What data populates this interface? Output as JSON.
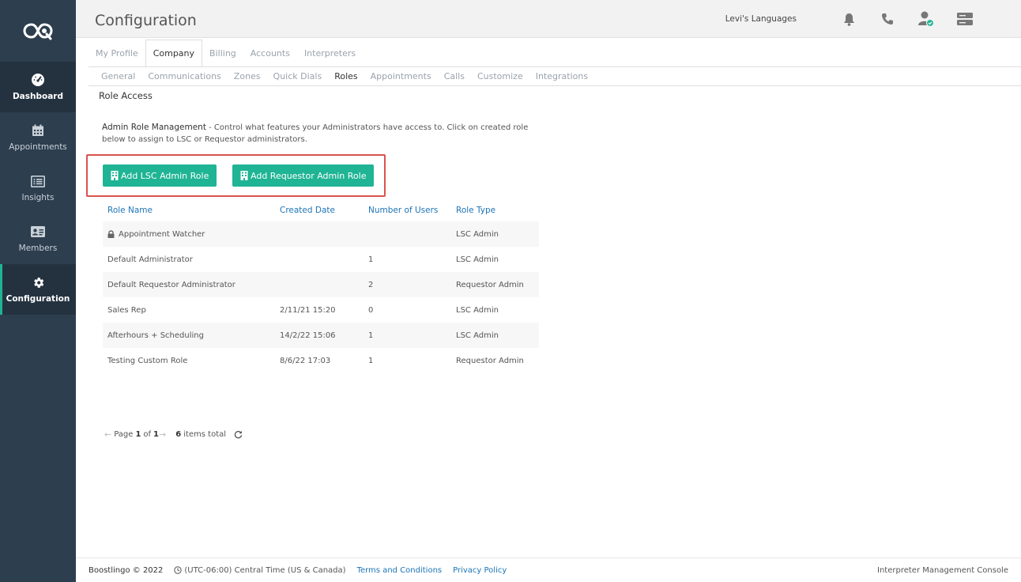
{
  "header": {
    "title": "Configuration",
    "account_name": "Levi's Languages"
  },
  "sidebar": {
    "items": [
      {
        "label": "Dashboard",
        "icon": "gauge-icon"
      },
      {
        "label": "Appointments",
        "icon": "calendar-icon"
      },
      {
        "label": "Insights",
        "icon": "list-icon"
      },
      {
        "label": "Members",
        "icon": "id-card-icon"
      },
      {
        "label": "Configuration",
        "icon": "gear-icon"
      }
    ]
  },
  "tabs": [
    "My Profile",
    "Company",
    "Billing",
    "Accounts",
    "Interpreters"
  ],
  "subtabs": [
    "General",
    "Communications",
    "Zones",
    "Quick Dials",
    "Roles",
    "Appointments",
    "Calls",
    "Customize",
    "Integrations"
  ],
  "section_title": "Role Access",
  "description": {
    "bold": "Admin Role Management",
    "text": " - Control what features your Administrators have access to. Click on created role below to assign to LSC or Requestor administrators."
  },
  "buttons": {
    "add_lsc": "Add LSC Admin Role",
    "add_requestor": "Add Requestor Admin Role"
  },
  "table": {
    "columns": [
      "Role Name",
      "Created Date",
      "Number of Users",
      "Role Type"
    ],
    "rows": [
      {
        "name": "Appointment Watcher",
        "created": "",
        "users": "",
        "type": "LSC Admin",
        "locked": true
      },
      {
        "name": "Default Administrator",
        "created": "",
        "users": "1",
        "type": "LSC Admin"
      },
      {
        "name": "Default Requestor Administrator",
        "created": "",
        "users": "2",
        "type": "Requestor Admin"
      },
      {
        "name": "Sales Rep",
        "created": "2/11/21 15:20",
        "users": "0",
        "type": "LSC Admin"
      },
      {
        "name": "Afterhours + Scheduling",
        "created": "14/2/22 15:06",
        "users": "1",
        "type": "LSC Admin"
      },
      {
        "name": "Testing Custom Role",
        "created": "8/6/22 17:03",
        "users": "1",
        "type": "Requestor Admin"
      }
    ]
  },
  "pager": {
    "page_label": "Page",
    "page": "1",
    "of_label": "of",
    "total_pages": "1",
    "items_count": "6",
    "items_label": "items total"
  },
  "footer": {
    "brand": "Boostlingo © 2022",
    "timezone": "(UTC-06:00) Central Time (US & Canada)",
    "terms": "Terms and Conditions",
    "privacy": "Privacy Policy",
    "console": "Interpreter Management Console"
  },
  "colors": {
    "sidebar": "#2d3e4e",
    "accent": "#1fb494",
    "link": "#1d74b6",
    "highlight": "#d9534f"
  }
}
